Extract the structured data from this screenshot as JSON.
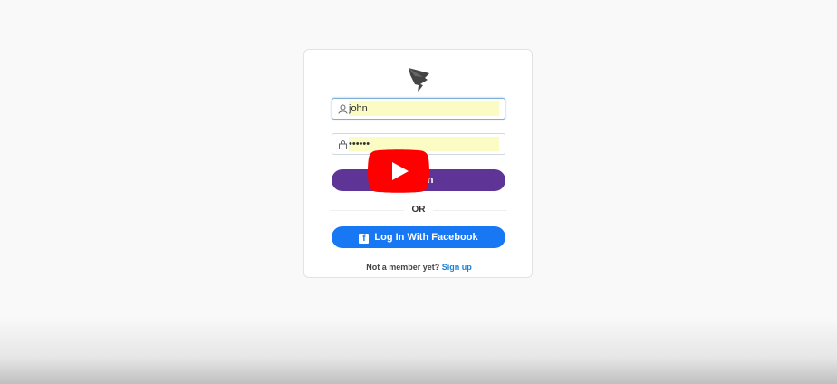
{
  "login": {
    "username_value": "john",
    "password_value": "••••••",
    "login_button_label": "Log In",
    "or_label": "OR",
    "facebook_button_label": "Log In With Facebook",
    "facebook_icon_letter": "f",
    "signup_prompt": "Not a member yet?",
    "signup_link_label": "Sign up"
  },
  "overlay": {
    "icon": "youtube-play-icon"
  },
  "colors": {
    "login_button": "#5f3497",
    "facebook_button": "#1877f2",
    "autofill_background": "#fbfbc4",
    "signup_link": "#1d7fd3",
    "youtube_red": "#ff0000"
  }
}
